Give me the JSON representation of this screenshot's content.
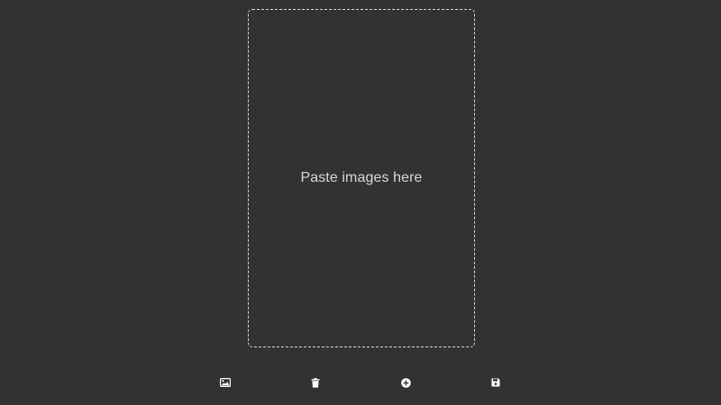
{
  "paste_area": {
    "hint": "Paste images here"
  },
  "toolbar": {
    "buttons": [
      {
        "icon": "image-icon"
      },
      {
        "icon": "trash-icon"
      },
      {
        "icon": "plus-circle-icon"
      },
      {
        "icon": "floppy-disk-icon"
      }
    ]
  },
  "colors": {
    "background": "#323232",
    "border": "#d9d9d9",
    "text": "#d8d8d8",
    "icon": "#ffffff"
  }
}
